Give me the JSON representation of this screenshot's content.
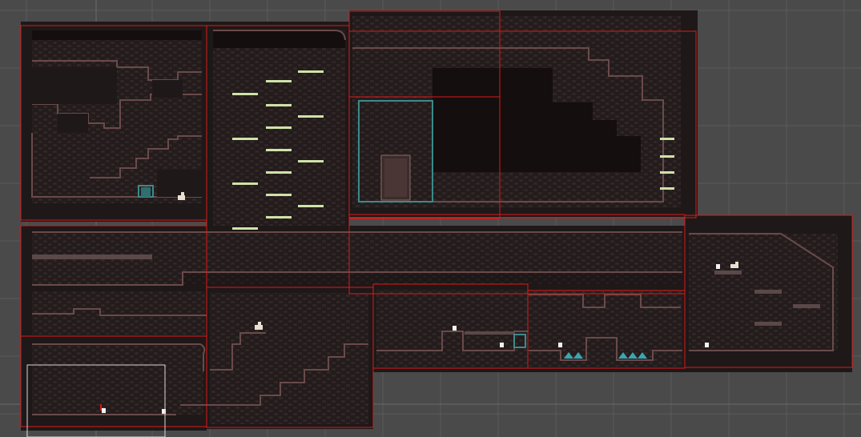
{
  "scene": {
    "view": "level-editor-scene",
    "background_color": "#4a4a4a",
    "room_border_color": "#e01818",
    "camera_frame_color": "#d8d8d8",
    "tile_color": "#2a2020"
  },
  "markers": [
    {
      "name": "spawn-marker-1"
    },
    {
      "name": "spawn-marker-2"
    },
    {
      "name": "spawn-marker-3"
    },
    {
      "name": "spawn-marker-4"
    },
    {
      "name": "spawn-marker-5"
    },
    {
      "name": "spawn-marker-6"
    }
  ],
  "entities": [
    {
      "name": "player-sprite"
    },
    {
      "name": "enemy-sprite"
    },
    {
      "name": "crawler-sprite"
    },
    {
      "name": "save-statue"
    }
  ]
}
